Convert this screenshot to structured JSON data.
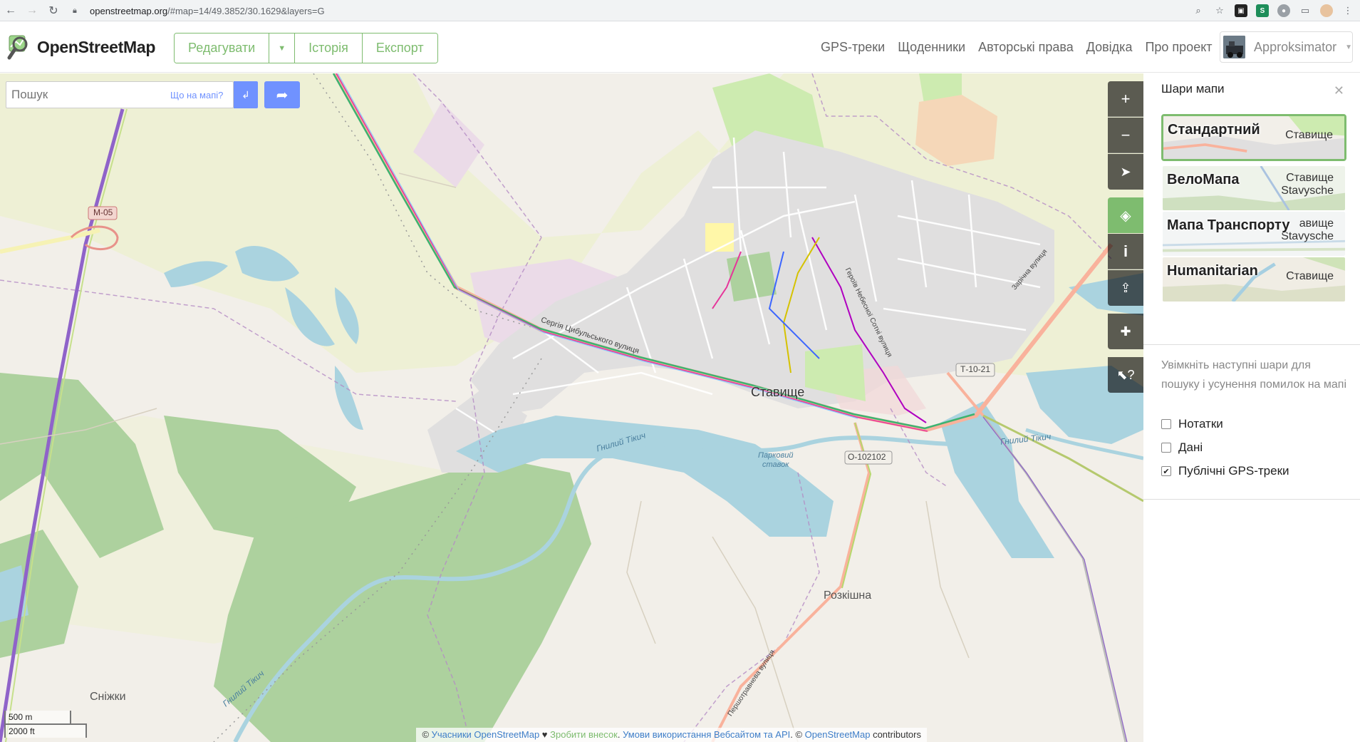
{
  "browser": {
    "url_host": "openstreetmap.org",
    "url_path": "/#map=14/49.3852/30.1629&layers=G"
  },
  "header": {
    "logo_text": "OpenStreetMap",
    "edit_label": "Редагувати",
    "history_label": "Історія",
    "export_label": "Експорт",
    "links": [
      "GPS-треки",
      "Щоденники",
      "Авторські права",
      "Довідка",
      "Про проект"
    ],
    "user_name": "Approksimator"
  },
  "search": {
    "placeholder": "Пошук",
    "what_here": "Що на мапі?"
  },
  "map": {
    "labels": {
      "town": "Ставище",
      "village_1": "Розкішна",
      "village_2": "Сніжки",
      "pond": "Парковий\nставок",
      "river_1": "Гнилий Тікич",
      "river_2": "Гнилий Тікич",
      "river_3": "Гнилий Тікич",
      "road_m05": "М-05",
      "road_t1021": "Т-10-21",
      "road_o102102": "О-102102",
      "street_1": "Сергія Цибульського вулиця",
      "street_2": "Героїв Небесної Сотні вулиця",
      "street_3": "Зарічна вулиця",
      "street_4": "Першотравнева вулиця"
    },
    "scale_metric": "500 m",
    "scale_imperial": "2000 ft",
    "colors": {
      "land": "#f2efe9",
      "residential": "#e0dfdf",
      "forest": "#add19e",
      "grass": "#cdebb0",
      "farmland": "#eef0d5",
      "water": "#aad3df",
      "industrial": "#ebdbe8",
      "accent": "#7ebc6f",
      "search_blue": "#7092ff"
    }
  },
  "attribution": {
    "prefix": "© ",
    "contributors": "Учасники OpenStreetMap",
    "heart": " ♥ ",
    "donate": "Зробити внесок",
    "sep": ". ",
    "terms": "Умови використання Вебсайтом та API",
    "suffix1": ". © ",
    "osm": "OpenStreetMap",
    "suffix2": " contributors"
  },
  "sidebar": {
    "title": "Шари мапи",
    "layers": [
      {
        "name": "Стандартний",
        "town": "Ставище",
        "town2": "",
        "selected": true
      },
      {
        "name": "ВелоМапа",
        "town": "Ставище",
        "town2": "Stavysche",
        "selected": false
      },
      {
        "name": "Мапа Транспорту",
        "town": "авище",
        "town2": "Stavysche",
        "selected": false
      },
      {
        "name": "Humanitarian",
        "town": "Ставище",
        "town2": "",
        "selected": false
      }
    ],
    "overlay_note": "Увімкніть наступні шари для пошуку і усунення помилок на мапі",
    "overlays": [
      {
        "label": "Нотатки",
        "checked": false
      },
      {
        "label": "Дані",
        "checked": false
      },
      {
        "label": "Публічні GPS-треки",
        "checked": true
      }
    ]
  }
}
